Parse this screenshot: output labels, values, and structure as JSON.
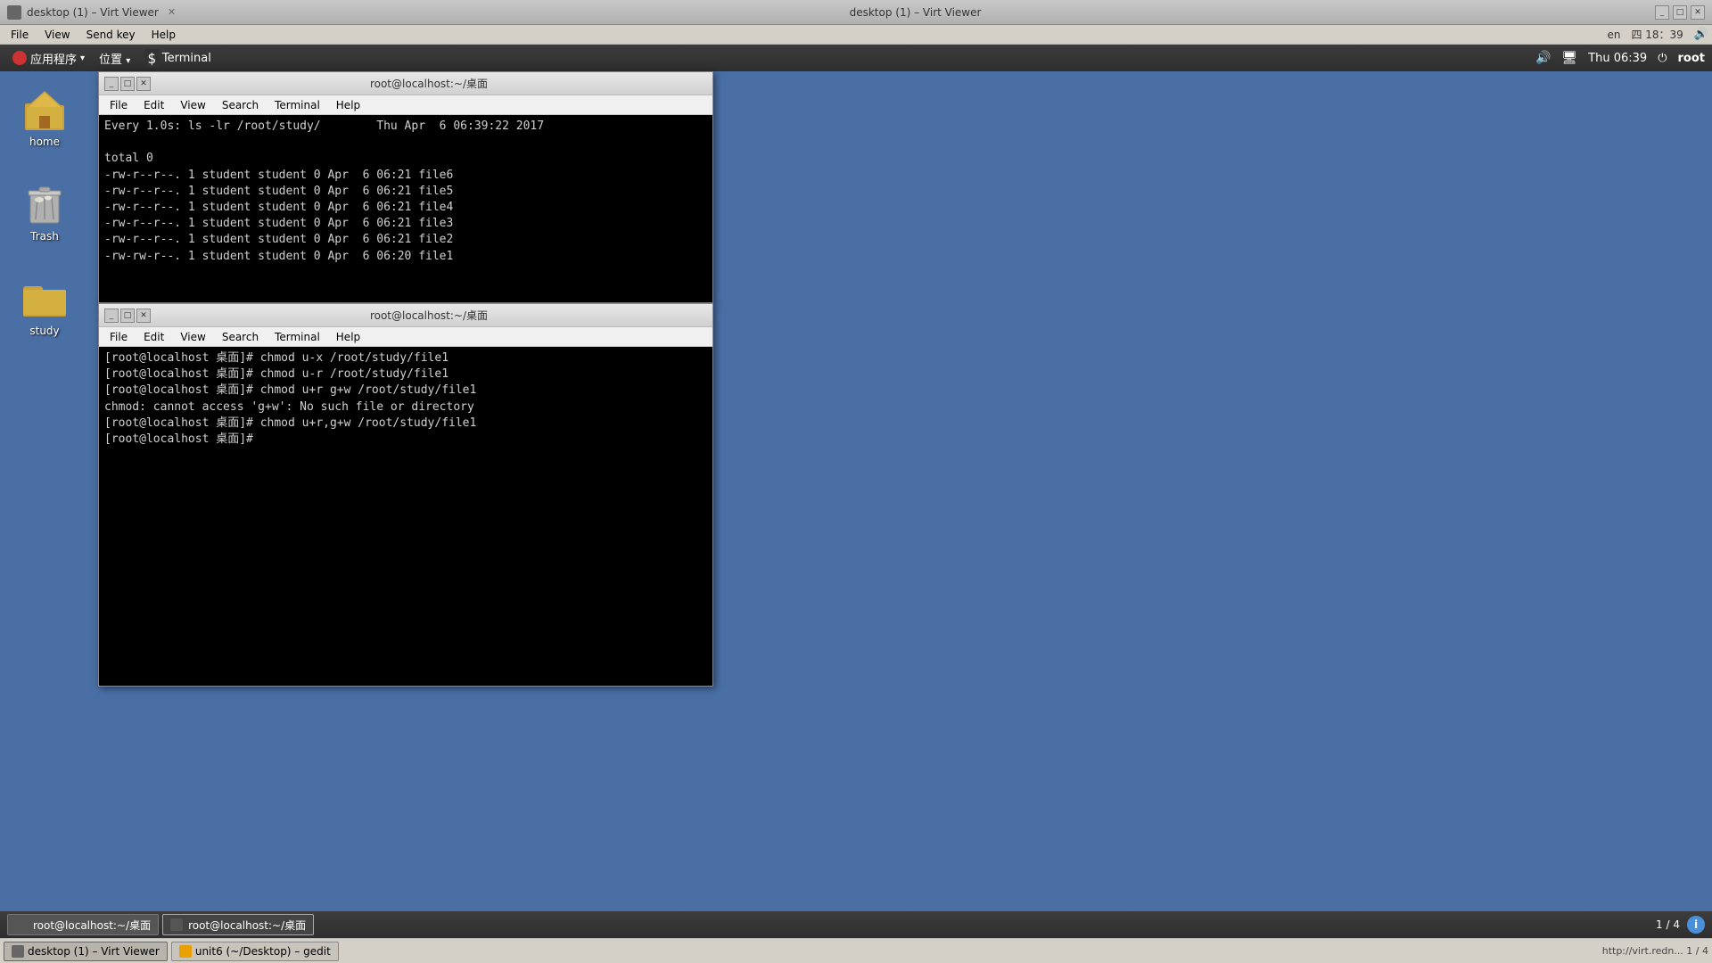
{
  "host": {
    "titlebar": {
      "title": "desktop (1) – Virt Viewer",
      "tab_label": "desktop (1) – Virt Viewer"
    },
    "menubar": {
      "items": [
        "File",
        "View",
        "Send key",
        "Help"
      ]
    },
    "systray": {
      "lang": "en",
      "datetime": "四 18：39"
    },
    "taskbar": {
      "items": [
        {
          "label": "desktop (1) – Virt Viewer",
          "active": true
        },
        {
          "label": "unit6 (~/Desktop) – gedit",
          "active": false
        }
      ],
      "right_text": "http://virt.redn... 1 / 4"
    }
  },
  "guest": {
    "panel": {
      "apps_label": "应用程序",
      "places_label": "位置",
      "terminal_label": "Terminal",
      "clock": "Thu 06:39",
      "user": "root"
    },
    "desktop_icons": [
      {
        "id": "home",
        "label": "home",
        "type": "home-folder"
      },
      {
        "id": "trash",
        "label": "Trash",
        "type": "trash"
      },
      {
        "id": "study",
        "label": "study",
        "type": "folder"
      }
    ],
    "terminal1": {
      "title": "root@localhost:~/桌面",
      "menubar": [
        "File",
        "Edit",
        "View",
        "Search",
        "Terminal",
        "Help"
      ],
      "content": "Every 1.0s: ls -lr /root/study/        Thu Apr  6 06:39:22 2017\n\ntotal 0\n-rw-r--r--. 1 student student 0 Apr  6 06:21 file6\n-rw-r--r--. 1 student student 0 Apr  6 06:21 file5\n-rw-r--r--. 1 student student 0 Apr  6 06:21 file4\n-rw-r--r--. 1 student student 0 Apr  6 06:21 file3\n-rw-r--r--. 1 student student 0 Apr  6 06:21 file2\n-rw-rw-r--. 1 student student 0 Apr  6 06:20 file1"
    },
    "terminal2": {
      "title": "root@localhost:~/桌面",
      "menubar": [
        "File",
        "Edit",
        "View",
        "Search",
        "Terminal",
        "Help"
      ],
      "content": "[root@localhost 桌面]# chmod u-x /root/study/file1\n[root@localhost 桌面]# chmod u-r /root/study/file1\n[root@localhost 桌面]# chmod u+r g+w /root/study/file1\nchmod: cannot access 'g+w': No such file or directory\n[root@localhost 桌面]# chmod u+r,g+w /root/study/file1\n[root@localhost 桌面]# "
    },
    "taskbar": {
      "items": [
        {
          "label": "root@localhost:~/桌面",
          "active": false
        },
        {
          "label": "root@localhost:~/桌面",
          "active": true
        }
      ],
      "pager": "1 / 4"
    }
  }
}
